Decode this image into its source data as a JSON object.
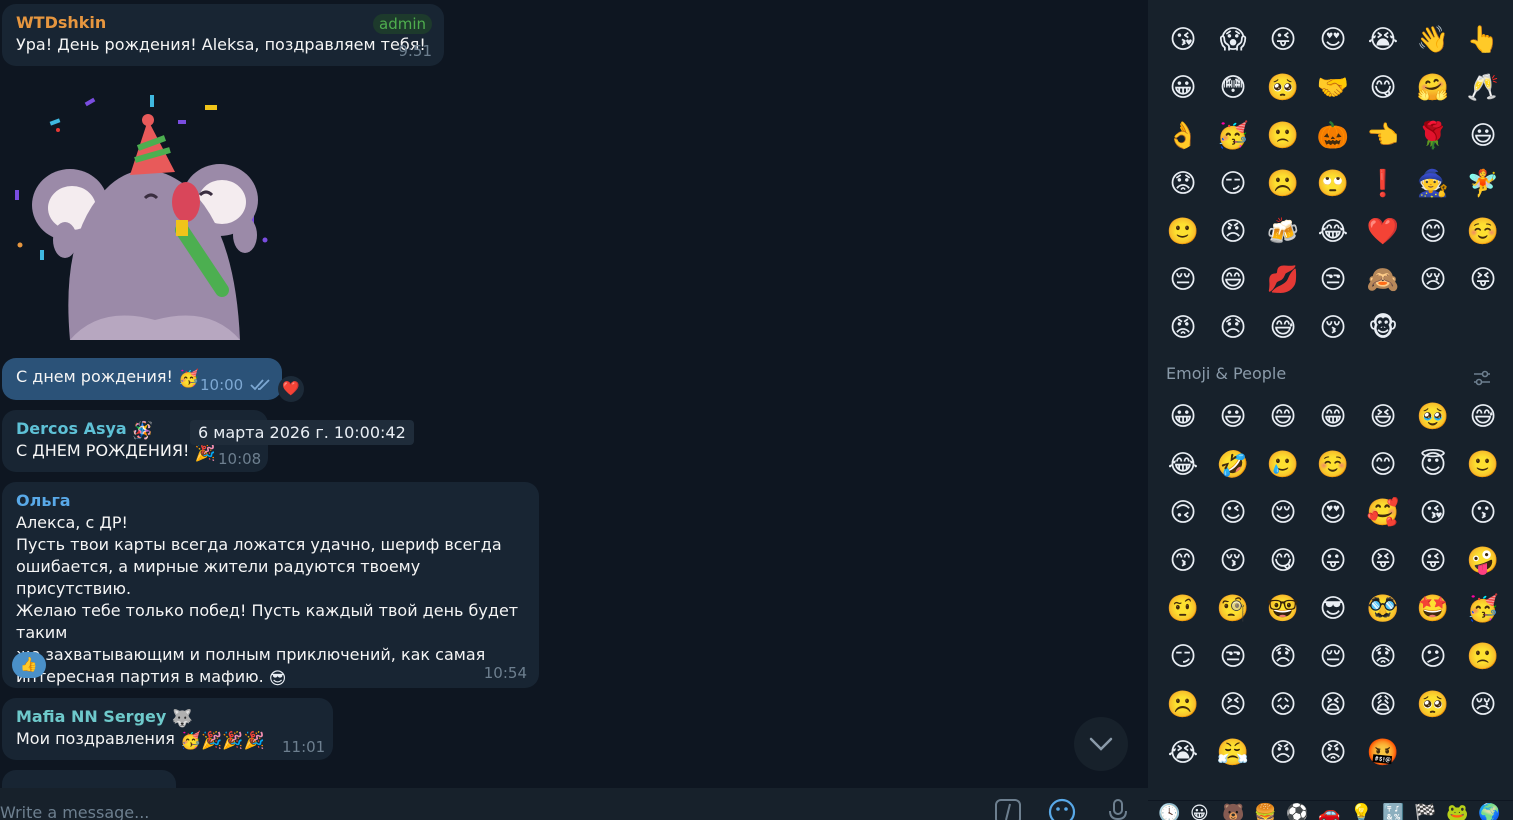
{
  "messages": {
    "m1": {
      "sender": "WTDshkin",
      "sender_color": "#e6963f",
      "badge": "admin",
      "text": "Ура! День рождения! Aleksa, поздравляем тебя!",
      "time": "9:51"
    },
    "m2": {
      "text": "С днем рождения!",
      "emoji": "🥳",
      "time": "10:00",
      "reaction": "❤️"
    },
    "m3": {
      "sender": "Dercos Asya",
      "sender_emoji": "🪅",
      "sender_color": "#5ec1d6",
      "text": "С ДНЕМ РОЖДЕНИЯ!",
      "emoji": "🎉",
      "time": "10:08",
      "tooltip": "6 марта 2026 г. 10:00:42"
    },
    "m4": {
      "sender": "Ольга",
      "sender_color": "#59a9e8",
      "line1": "Алекса, с ДР!",
      "line2": "Пусть твои карты всегда ложатся удачно, шериф всегда",
      "line3": "ошибается, а мирные жители радуются твоему присутствию.",
      "line4": "Желаю тебе только побед! Пусть каждый твой день будет таким",
      "line5": "же захватывающим и полным приключений, как самая",
      "line6": "интересная партия в мафию.",
      "emoji": "😎",
      "time": "10:54",
      "reaction": "👍"
    },
    "m5": {
      "sender": "Mafia NN Sergey",
      "sender_emoji": "🐺",
      "sender_color": "#6ec9cb",
      "text": "Мои поздравления",
      "emoji": "🥳🎉🎉🎉",
      "time": "11:01"
    }
  },
  "input": {
    "placeholder": "Write a message..."
  },
  "emoji_panel": {
    "recent": [
      "😘",
      "😱",
      "😜",
      "😍",
      "😭",
      "👋",
      "👆",
      "😀",
      "😳",
      "🥺",
      "🤝",
      "😋",
      "🤗",
      "🥂",
      "👌",
      "🥳",
      "🙁",
      "🎃",
      "👈",
      "🌹",
      "😃",
      "😟",
      "😏",
      "☹️",
      "🙄",
      "❗",
      "🧙",
      "🧚",
      "🙂",
      "😠",
      "🍻",
      "😂",
      "❤️",
      "😊",
      "☺️",
      "😔",
      "😄",
      "💋",
      "😒",
      "🙈",
      "😢",
      "😝",
      "😡",
      "😞",
      "😅",
      "😚",
      "🐵"
    ],
    "section_title": "Emoji & People",
    "people": [
      "😀",
      "😃",
      "😄",
      "😁",
      "😆",
      "🥹",
      "😅",
      "😂",
      "🤣",
      "🥲",
      "☺️",
      "😊",
      "😇",
      "🙂",
      "🙃",
      "😉",
      "😌",
      "😍",
      "🥰",
      "😘",
      "😗",
      "😙",
      "😚",
      "😋",
      "😛",
      "😝",
      "😜",
      "🤪",
      "🤨",
      "🧐",
      "🤓",
      "😎",
      "🥸",
      "🤩",
      "🥳",
      "😏",
      "😒",
      "😞",
      "😔",
      "😟",
      "😕",
      "🙁",
      "☹️",
      "😣",
      "😖",
      "😫",
      "😩",
      "🥺",
      "😢",
      "😭",
      "😤",
      "😠",
      "😡",
      "🤬"
    ],
    "tabs": [
      "🕓",
      "😀",
      "🐻",
      "🍔",
      "⚽",
      "🚗",
      "💡",
      "🔣",
      "🏁",
      "🐸",
      "🌍"
    ]
  },
  "colors": {
    "bg": "#0e1621",
    "bubble_in": "#182533",
    "bubble_out": "#2b5278",
    "panel": "#17212b"
  }
}
